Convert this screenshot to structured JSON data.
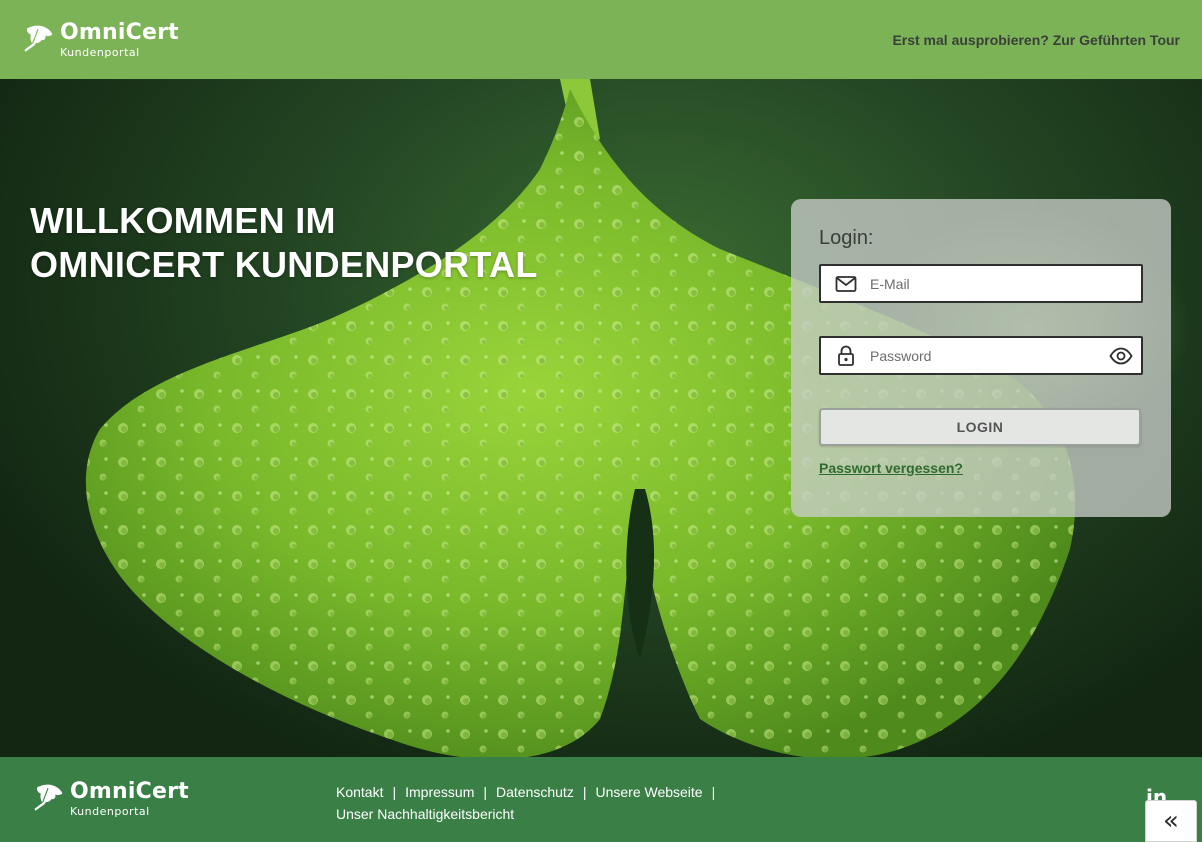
{
  "header": {
    "logo_name": "OmniCert",
    "logo_sub": "Kundenportal",
    "tour_link": "Erst mal ausprobieren? Zur Geführten Tour"
  },
  "hero": {
    "title_line1": "WILLKOMMEN IM",
    "title_line2": "OMNICERT KUNDENPORTAL"
  },
  "login": {
    "title": "Login:",
    "email_placeholder": "E-Mail",
    "email_value": "",
    "password_placeholder": "Password",
    "password_value": "",
    "button_label": "LOGIN",
    "forgot_link": "Passwort vergessen?"
  },
  "footer": {
    "logo_name": "OmniCert",
    "logo_sub": "Kundenportal",
    "links": [
      "Kontakt",
      "Impressum",
      "Datenschutz",
      "Unsere Webseite",
      "Unser Nachhaltigkeitsbericht"
    ],
    "separator": "|",
    "social_label": "in",
    "collapse_label": "«"
  },
  "icons": {
    "logo": "ginkgo-leaf-icon",
    "email": "mail-icon",
    "password": "lock-icon",
    "toggle": "eye-icon",
    "social": "linkedin-icon",
    "collapse": "double-chevron-left-icon"
  },
  "colors": {
    "header_bg": "#7cb356",
    "footer_bg": "#397f46",
    "leaf_green": "#7fbf2a",
    "link_green": "#2f6b2f"
  }
}
